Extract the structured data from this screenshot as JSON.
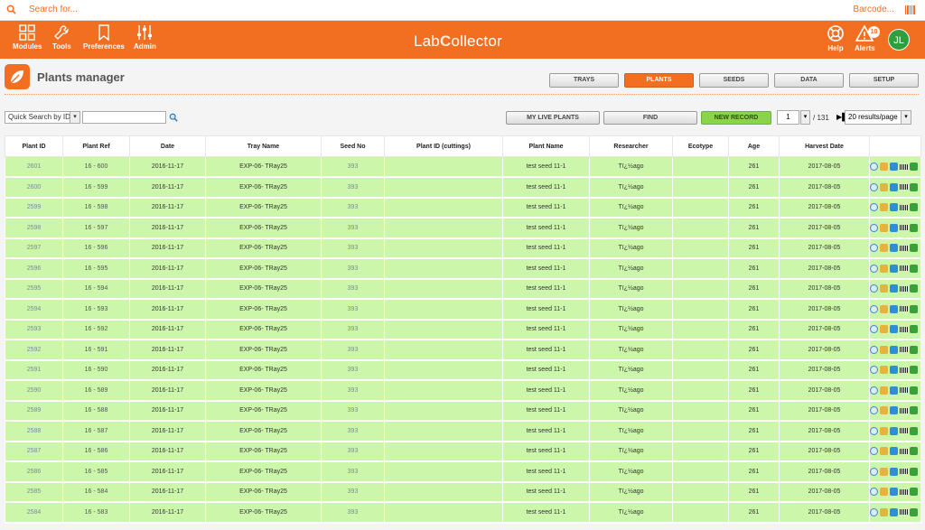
{
  "topbar": {
    "search_placeholder": "Search for...",
    "barcode_placeholder": "Barcode..."
  },
  "nav": {
    "items": [
      {
        "label": "Modules",
        "icon": "grid-icon"
      },
      {
        "label": "Tools",
        "icon": "wrench-icon"
      },
      {
        "label": "Preferences",
        "icon": "bookmark-icon"
      },
      {
        "label": "Admin",
        "icon": "sliders-icon"
      }
    ],
    "logo_text_a": "Lab",
    "logo_text_b": "C",
    "logo_text_c": "ollector",
    "help_label": "Help",
    "alerts_label": "Alerts",
    "alerts_count": "10",
    "user_initials": "JL"
  },
  "page": {
    "title": "Plants manager",
    "tabs": [
      "TRAYS",
      "PLANTS",
      "SEEDS",
      "DATA",
      "SETUP"
    ],
    "active_tab": "PLANTS"
  },
  "toolbar": {
    "quick_search_label": "Quick Search by ID",
    "search_value": "",
    "my_live_plants": "MY LIVE PLANTS",
    "find": "FIND",
    "new_record": "NEW RECORD",
    "page_number": "1",
    "page_total": "/ 131",
    "results_per_page": "20 results/page"
  },
  "table": {
    "columns": [
      "Plant ID",
      "Plant Ref",
      "Date",
      "Tray Name",
      "Seed No",
      "Plant ID (cuttings)",
      "Plant Name",
      "Researcher",
      "Ecotype",
      "Age",
      "Harvest Date",
      ""
    ],
    "rows": [
      [
        "2601",
        "16 - 600",
        "2016-11-17",
        "EXP-06- TRay25",
        "393",
        "",
        "test seed 11-1",
        "Tï¿½ago",
        "",
        "261",
        "2017-08-05"
      ],
      [
        "2600",
        "16 - 599",
        "2016-11-17",
        "EXP-06- TRay25",
        "393",
        "",
        "test seed 11-1",
        "Tï¿½ago",
        "",
        "261",
        "2017-08-05"
      ],
      [
        "2599",
        "16 - 598",
        "2016-11-17",
        "EXP-06- TRay25",
        "393",
        "",
        "test seed 11-1",
        "Tï¿½ago",
        "",
        "261",
        "2017-08-05"
      ],
      [
        "2598",
        "16 - 597",
        "2016-11-17",
        "EXP-06- TRay25",
        "393",
        "",
        "test seed 11-1",
        "Tï¿½ago",
        "",
        "261",
        "2017-08-05"
      ],
      [
        "2597",
        "16 - 596",
        "2016-11-17",
        "EXP-06- TRay25",
        "393",
        "",
        "test seed 11-1",
        "Tï¿½ago",
        "",
        "261",
        "2017-08-05"
      ],
      [
        "2596",
        "16 - 595",
        "2016-11-17",
        "EXP-06- TRay25",
        "393",
        "",
        "test seed 11-1",
        "Tï¿½ago",
        "",
        "261",
        "2017-08-05"
      ],
      [
        "2595",
        "16 - 594",
        "2016-11-17",
        "EXP-06- TRay25",
        "393",
        "",
        "test seed 11-1",
        "Tï¿½ago",
        "",
        "261",
        "2017-08-05"
      ],
      [
        "2594",
        "16 - 593",
        "2016-11-17",
        "EXP-06- TRay25",
        "393",
        "",
        "test seed 11-1",
        "Tï¿½ago",
        "",
        "261",
        "2017-08-05"
      ],
      [
        "2593",
        "16 - 592",
        "2016-11-17",
        "EXP-06- TRay25",
        "393",
        "",
        "test seed 11-1",
        "Tï¿½ago",
        "",
        "261",
        "2017-08-05"
      ],
      [
        "2592",
        "16 - 591",
        "2016-11-17",
        "EXP-06- TRay25",
        "393",
        "",
        "test seed 11-1",
        "Tï¿½ago",
        "",
        "261",
        "2017-08-05"
      ],
      [
        "2591",
        "16 - 590",
        "2016-11-17",
        "EXP-06- TRay25",
        "393",
        "",
        "test seed 11-1",
        "Tï¿½ago",
        "",
        "261",
        "2017-08-05"
      ],
      [
        "2590",
        "16 - 589",
        "2016-11-17",
        "EXP-06- TRay25",
        "393",
        "",
        "test seed 11-1",
        "Tï¿½ago",
        "",
        "261",
        "2017-08-05"
      ],
      [
        "2589",
        "16 - 588",
        "2016-11-17",
        "EXP-06- TRay25",
        "393",
        "",
        "test seed 11-1",
        "Tï¿½ago",
        "",
        "261",
        "2017-08-05"
      ],
      [
        "2588",
        "16 - 587",
        "2016-11-17",
        "EXP-06- TRay25",
        "393",
        "",
        "test seed 11-1",
        "Tï¿½ago",
        "",
        "261",
        "2017-08-05"
      ],
      [
        "2587",
        "16 - 586",
        "2016-11-17",
        "EXP-06- TRay25",
        "393",
        "",
        "test seed 11-1",
        "Tï¿½ago",
        "",
        "261",
        "2017-08-05"
      ],
      [
        "2586",
        "16 - 585",
        "2016-11-17",
        "EXP-06- TRay25",
        "393",
        "",
        "test seed 11-1",
        "Tï¿½ago",
        "",
        "261",
        "2017-08-05"
      ],
      [
        "2585",
        "16 - 584",
        "2016-11-17",
        "EXP-06- TRay25",
        "393",
        "",
        "test seed 11-1",
        "Tï¿½ago",
        "",
        "261",
        "2017-08-05"
      ],
      [
        "2584",
        "16 - 583",
        "2016-11-17",
        "EXP-06- TRay25",
        "393",
        "",
        "test seed 11-1",
        "Tï¿½ago",
        "",
        "261",
        "2017-08-05"
      ]
    ],
    "row_actions": [
      "view-icon",
      "edit-icon",
      "copy-icon",
      "barcode-icon",
      "add-data-icon",
      "delete-icon"
    ]
  },
  "colors": {
    "accent": "#f26f21",
    "row_bg": "#ccf7aa",
    "new_record": "#8bd34a",
    "avatar": "#2e9f3e"
  }
}
